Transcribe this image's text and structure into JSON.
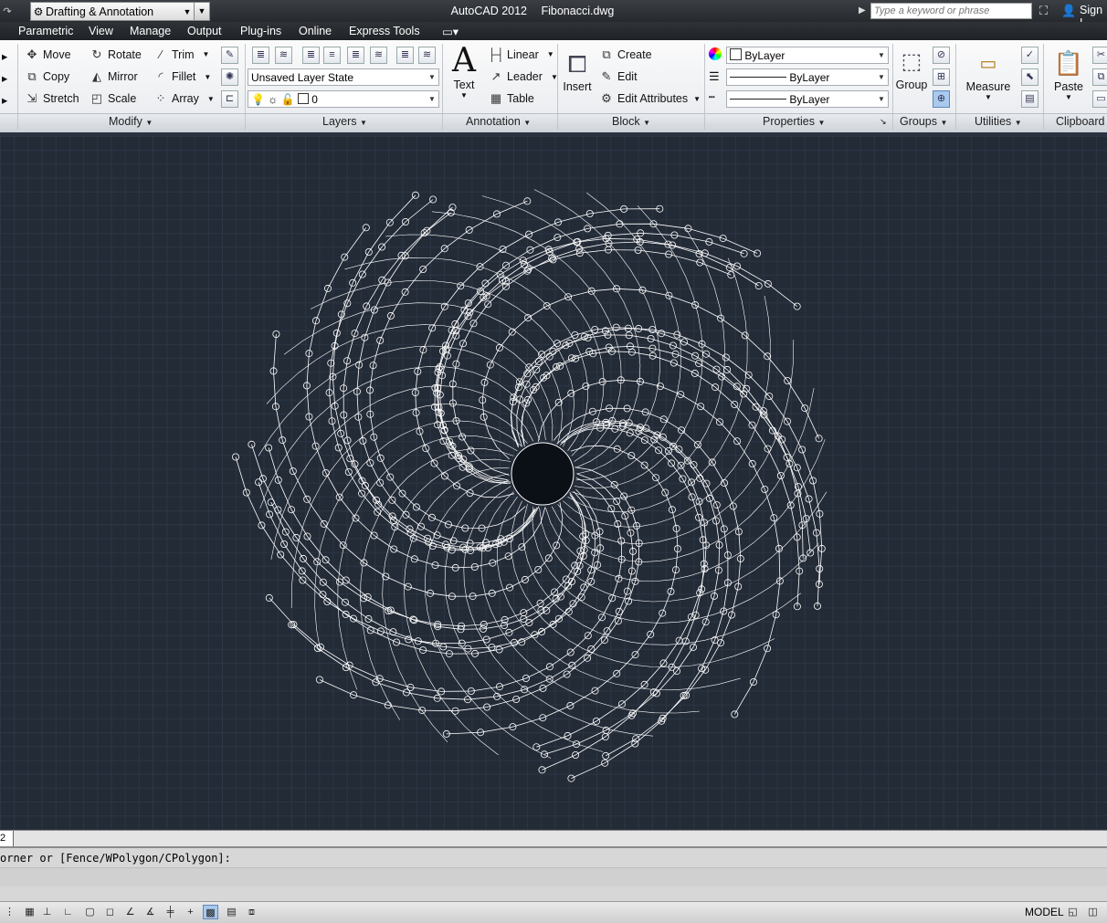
{
  "titlebar": {
    "workspace": "Drafting & Annotation",
    "app_name": "AutoCAD 2012",
    "file_name": "Fibonacci.dwg",
    "search_placeholder": "Type a keyword or phrase",
    "sign_in": "Sign I"
  },
  "menubar": {
    "items": [
      "Parametric",
      "View",
      "Manage",
      "Output",
      "Plug-ins",
      "Online",
      "Express Tools"
    ]
  },
  "ribbon": {
    "modify": {
      "title": "Modify",
      "move": "Move",
      "rotate": "Rotate",
      "trim": "Trim",
      "copy": "Copy",
      "mirror": "Mirror",
      "fillet": "Fillet",
      "stretch": "Stretch",
      "scale": "Scale",
      "array": "Array"
    },
    "layers": {
      "title": "Layers",
      "layer_state": "Unsaved Layer State",
      "current_layer": "0"
    },
    "annotation": {
      "title": "Annotation",
      "text": "Text",
      "linear": "Linear",
      "leader": "Leader",
      "table": "Table"
    },
    "block": {
      "title": "Block",
      "insert": "Insert",
      "create": "Create",
      "edit": "Edit",
      "edit_attributes": "Edit Attributes"
    },
    "properties": {
      "title": "Properties",
      "color": "ByLayer",
      "linetype": "ByLayer",
      "lineweight": "ByLayer"
    },
    "groups": {
      "title": "Groups",
      "group": "Group"
    },
    "utilities": {
      "title": "Utilities",
      "measure": "Measure"
    },
    "clipboard": {
      "title": "Clipboard",
      "paste": "Paste"
    }
  },
  "layout_tab": "2",
  "command_line": {
    "history": "orner or [Fence/WPolygon/CPolygon]:"
  },
  "status_bar": {
    "space": "MODEL"
  },
  "drawing": {
    "description_color": "#ffffff",
    "background": "#232b37"
  }
}
